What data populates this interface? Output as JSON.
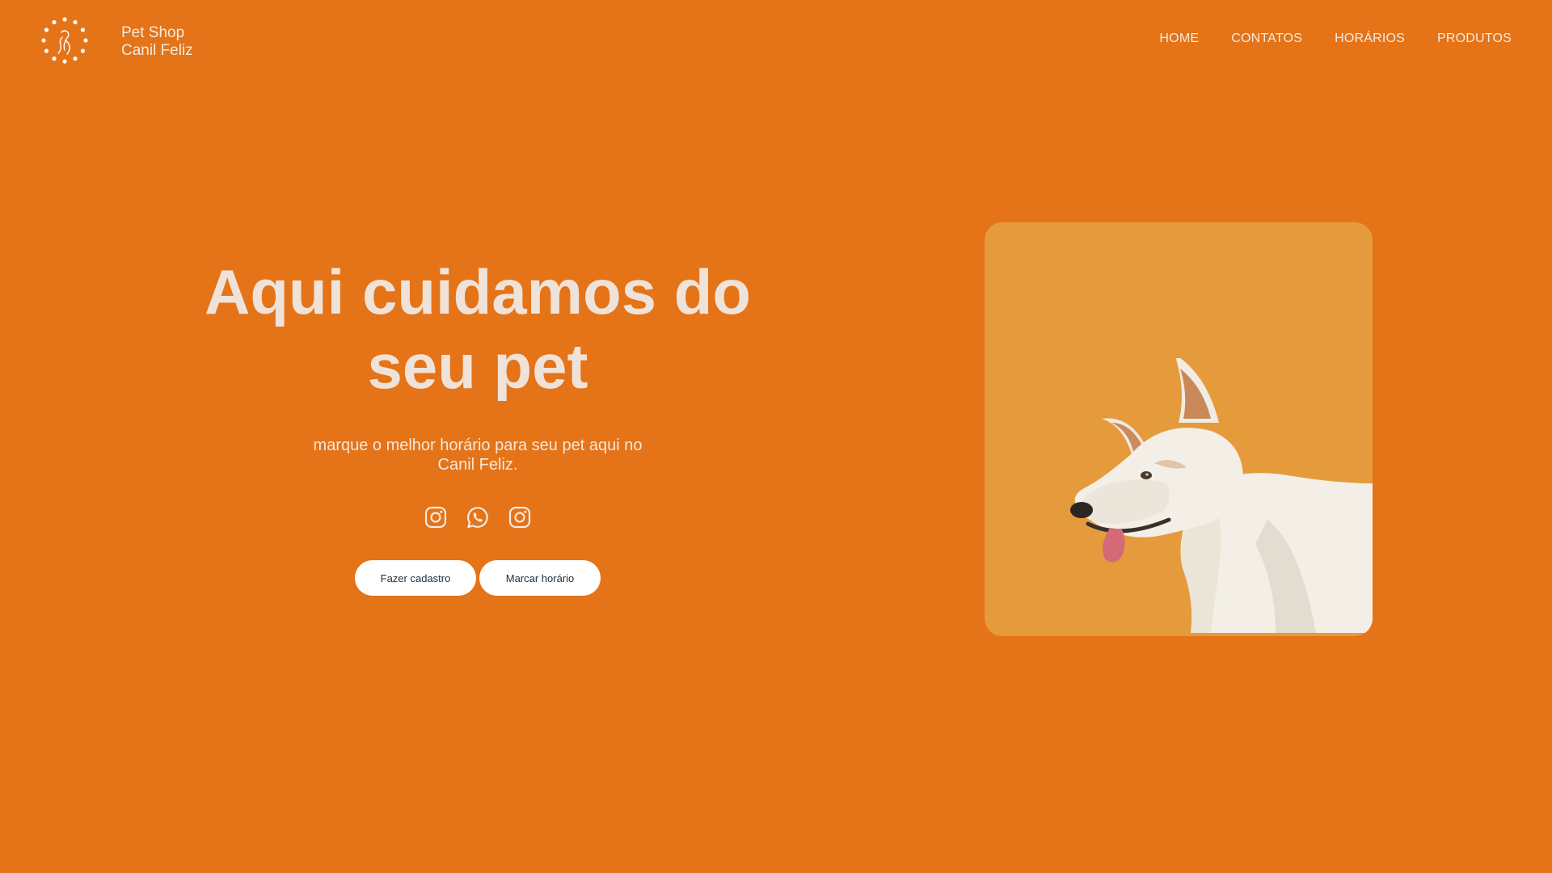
{
  "brand": {
    "line1": "Pet Shop",
    "line2": "Canil Feliz",
    "logo_icon": "paw-wreath-dog-logo"
  },
  "nav": {
    "items": [
      {
        "label": "HOME"
      },
      {
        "label": "CONTATOS"
      },
      {
        "label": "HORÁRIOS"
      },
      {
        "label": "PRODUTOS"
      }
    ]
  },
  "hero": {
    "title_line1": "Aqui cuidamos do",
    "title_line2": "seu pet",
    "subtitle": "marque o melhor horário para seu pet aqui no Canil Feliz.",
    "socials": [
      {
        "icon": "instagram-icon"
      },
      {
        "icon": "whatsapp-icon"
      },
      {
        "icon": "instagram-icon"
      }
    ],
    "buttons": {
      "signup": "Fazer cadastro",
      "schedule": "Marcar horário"
    }
  },
  "colors": {
    "background": "#e57318",
    "card": "#e59b3c",
    "text": "#efe3d9",
    "button_bg": "#ffffff",
    "button_text": "#1f2e3a"
  }
}
